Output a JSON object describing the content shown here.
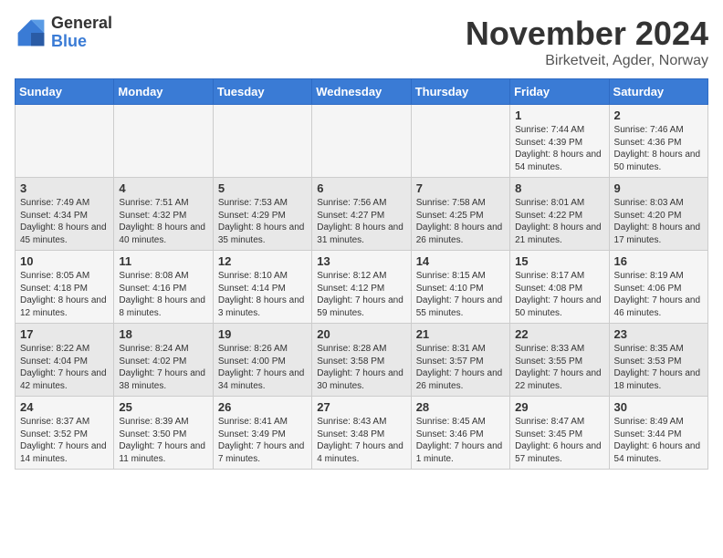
{
  "logo": {
    "general": "General",
    "blue": "Blue"
  },
  "title": "November 2024",
  "location": "Birketveit, Agder, Norway",
  "days_of_week": [
    "Sunday",
    "Monday",
    "Tuesday",
    "Wednesday",
    "Thursday",
    "Friday",
    "Saturday"
  ],
  "weeks": [
    [
      {
        "day": "",
        "info": ""
      },
      {
        "day": "",
        "info": ""
      },
      {
        "day": "",
        "info": ""
      },
      {
        "day": "",
        "info": ""
      },
      {
        "day": "",
        "info": ""
      },
      {
        "day": "1",
        "info": "Sunrise: 7:44 AM\nSunset: 4:39 PM\nDaylight: 8 hours and 54 minutes."
      },
      {
        "day": "2",
        "info": "Sunrise: 7:46 AM\nSunset: 4:36 PM\nDaylight: 8 hours and 50 minutes."
      }
    ],
    [
      {
        "day": "3",
        "info": "Sunrise: 7:49 AM\nSunset: 4:34 PM\nDaylight: 8 hours and 45 minutes."
      },
      {
        "day": "4",
        "info": "Sunrise: 7:51 AM\nSunset: 4:32 PM\nDaylight: 8 hours and 40 minutes."
      },
      {
        "day": "5",
        "info": "Sunrise: 7:53 AM\nSunset: 4:29 PM\nDaylight: 8 hours and 35 minutes."
      },
      {
        "day": "6",
        "info": "Sunrise: 7:56 AM\nSunset: 4:27 PM\nDaylight: 8 hours and 31 minutes."
      },
      {
        "day": "7",
        "info": "Sunrise: 7:58 AM\nSunset: 4:25 PM\nDaylight: 8 hours and 26 minutes."
      },
      {
        "day": "8",
        "info": "Sunrise: 8:01 AM\nSunset: 4:22 PM\nDaylight: 8 hours and 21 minutes."
      },
      {
        "day": "9",
        "info": "Sunrise: 8:03 AM\nSunset: 4:20 PM\nDaylight: 8 hours and 17 minutes."
      }
    ],
    [
      {
        "day": "10",
        "info": "Sunrise: 8:05 AM\nSunset: 4:18 PM\nDaylight: 8 hours and 12 minutes."
      },
      {
        "day": "11",
        "info": "Sunrise: 8:08 AM\nSunset: 4:16 PM\nDaylight: 8 hours and 8 minutes."
      },
      {
        "day": "12",
        "info": "Sunrise: 8:10 AM\nSunset: 4:14 PM\nDaylight: 8 hours and 3 minutes."
      },
      {
        "day": "13",
        "info": "Sunrise: 8:12 AM\nSunset: 4:12 PM\nDaylight: 7 hours and 59 minutes."
      },
      {
        "day": "14",
        "info": "Sunrise: 8:15 AM\nSunset: 4:10 PM\nDaylight: 7 hours and 55 minutes."
      },
      {
        "day": "15",
        "info": "Sunrise: 8:17 AM\nSunset: 4:08 PM\nDaylight: 7 hours and 50 minutes."
      },
      {
        "day": "16",
        "info": "Sunrise: 8:19 AM\nSunset: 4:06 PM\nDaylight: 7 hours and 46 minutes."
      }
    ],
    [
      {
        "day": "17",
        "info": "Sunrise: 8:22 AM\nSunset: 4:04 PM\nDaylight: 7 hours and 42 minutes."
      },
      {
        "day": "18",
        "info": "Sunrise: 8:24 AM\nSunset: 4:02 PM\nDaylight: 7 hours and 38 minutes."
      },
      {
        "day": "19",
        "info": "Sunrise: 8:26 AM\nSunset: 4:00 PM\nDaylight: 7 hours and 34 minutes."
      },
      {
        "day": "20",
        "info": "Sunrise: 8:28 AM\nSunset: 3:58 PM\nDaylight: 7 hours and 30 minutes."
      },
      {
        "day": "21",
        "info": "Sunrise: 8:31 AM\nSunset: 3:57 PM\nDaylight: 7 hours and 26 minutes."
      },
      {
        "day": "22",
        "info": "Sunrise: 8:33 AM\nSunset: 3:55 PM\nDaylight: 7 hours and 22 minutes."
      },
      {
        "day": "23",
        "info": "Sunrise: 8:35 AM\nSunset: 3:53 PM\nDaylight: 7 hours and 18 minutes."
      }
    ],
    [
      {
        "day": "24",
        "info": "Sunrise: 8:37 AM\nSunset: 3:52 PM\nDaylight: 7 hours and 14 minutes."
      },
      {
        "day": "25",
        "info": "Sunrise: 8:39 AM\nSunset: 3:50 PM\nDaylight: 7 hours and 11 minutes."
      },
      {
        "day": "26",
        "info": "Sunrise: 8:41 AM\nSunset: 3:49 PM\nDaylight: 7 hours and 7 minutes."
      },
      {
        "day": "27",
        "info": "Sunrise: 8:43 AM\nSunset: 3:48 PM\nDaylight: 7 hours and 4 minutes."
      },
      {
        "day": "28",
        "info": "Sunrise: 8:45 AM\nSunset: 3:46 PM\nDaylight: 7 hours and 1 minute."
      },
      {
        "day": "29",
        "info": "Sunrise: 8:47 AM\nSunset: 3:45 PM\nDaylight: 6 hours and 57 minutes."
      },
      {
        "day": "30",
        "info": "Sunrise: 8:49 AM\nSunset: 3:44 PM\nDaylight: 6 hours and 54 minutes."
      }
    ]
  ]
}
